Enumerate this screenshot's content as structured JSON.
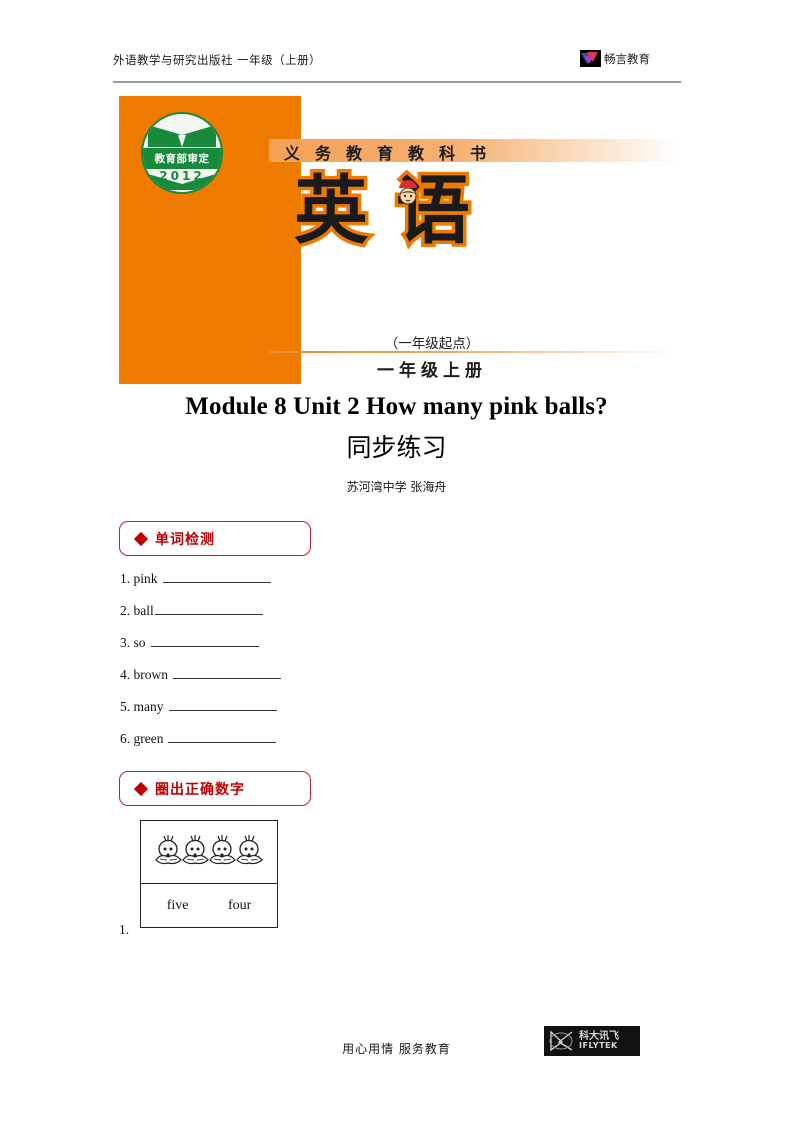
{
  "header": {
    "left_text": "外语教学与研究出版社 一年级（上册）",
    "logo_name": "changyan-bird-logo",
    "right_text": "畅言教育"
  },
  "cover": {
    "seal": {
      "band_text": "教育部审定",
      "year": "2012"
    },
    "band_text": "义务教育教科书",
    "title": "英语",
    "mascot_name": "cartoon-face-with-red-hat",
    "subtitle_1": "（一年级起点）",
    "subtitle_2": "一年级上册",
    "orange": "#ee7a00",
    "green": "#178a3c"
  },
  "doc": {
    "title_en": "Module 8 Unit 2 How many pink balls?",
    "title_cn": "同步练习",
    "author": "苏河湾中学  张海舟"
  },
  "sections": [
    {
      "id": "section-1",
      "bullet": "◆",
      "label": "单词检测"
    },
    {
      "id": "section-2",
      "bullet": "◆",
      "label": "圈出正确数字"
    }
  ],
  "words": [
    {
      "text": "1. pink"
    },
    {
      "text": "2. ball"
    },
    {
      "text": "3. so"
    },
    {
      "text": "4. brown"
    },
    {
      "text": "5. many"
    },
    {
      "text": "6. green"
    }
  ],
  "exercise": {
    "number": "1.",
    "picture": "four-chicks",
    "chick_count": 4,
    "options": [
      "five",
      "four"
    ]
  },
  "footer": {
    "text": "用心用情   服务教育",
    "logo_cn": "科大讯飞",
    "logo_en": "IFLYTEK"
  },
  "accent": {
    "red": "#c00000",
    "orange": "#ee7a00",
    "rule_gray": "#9a9a9a"
  }
}
